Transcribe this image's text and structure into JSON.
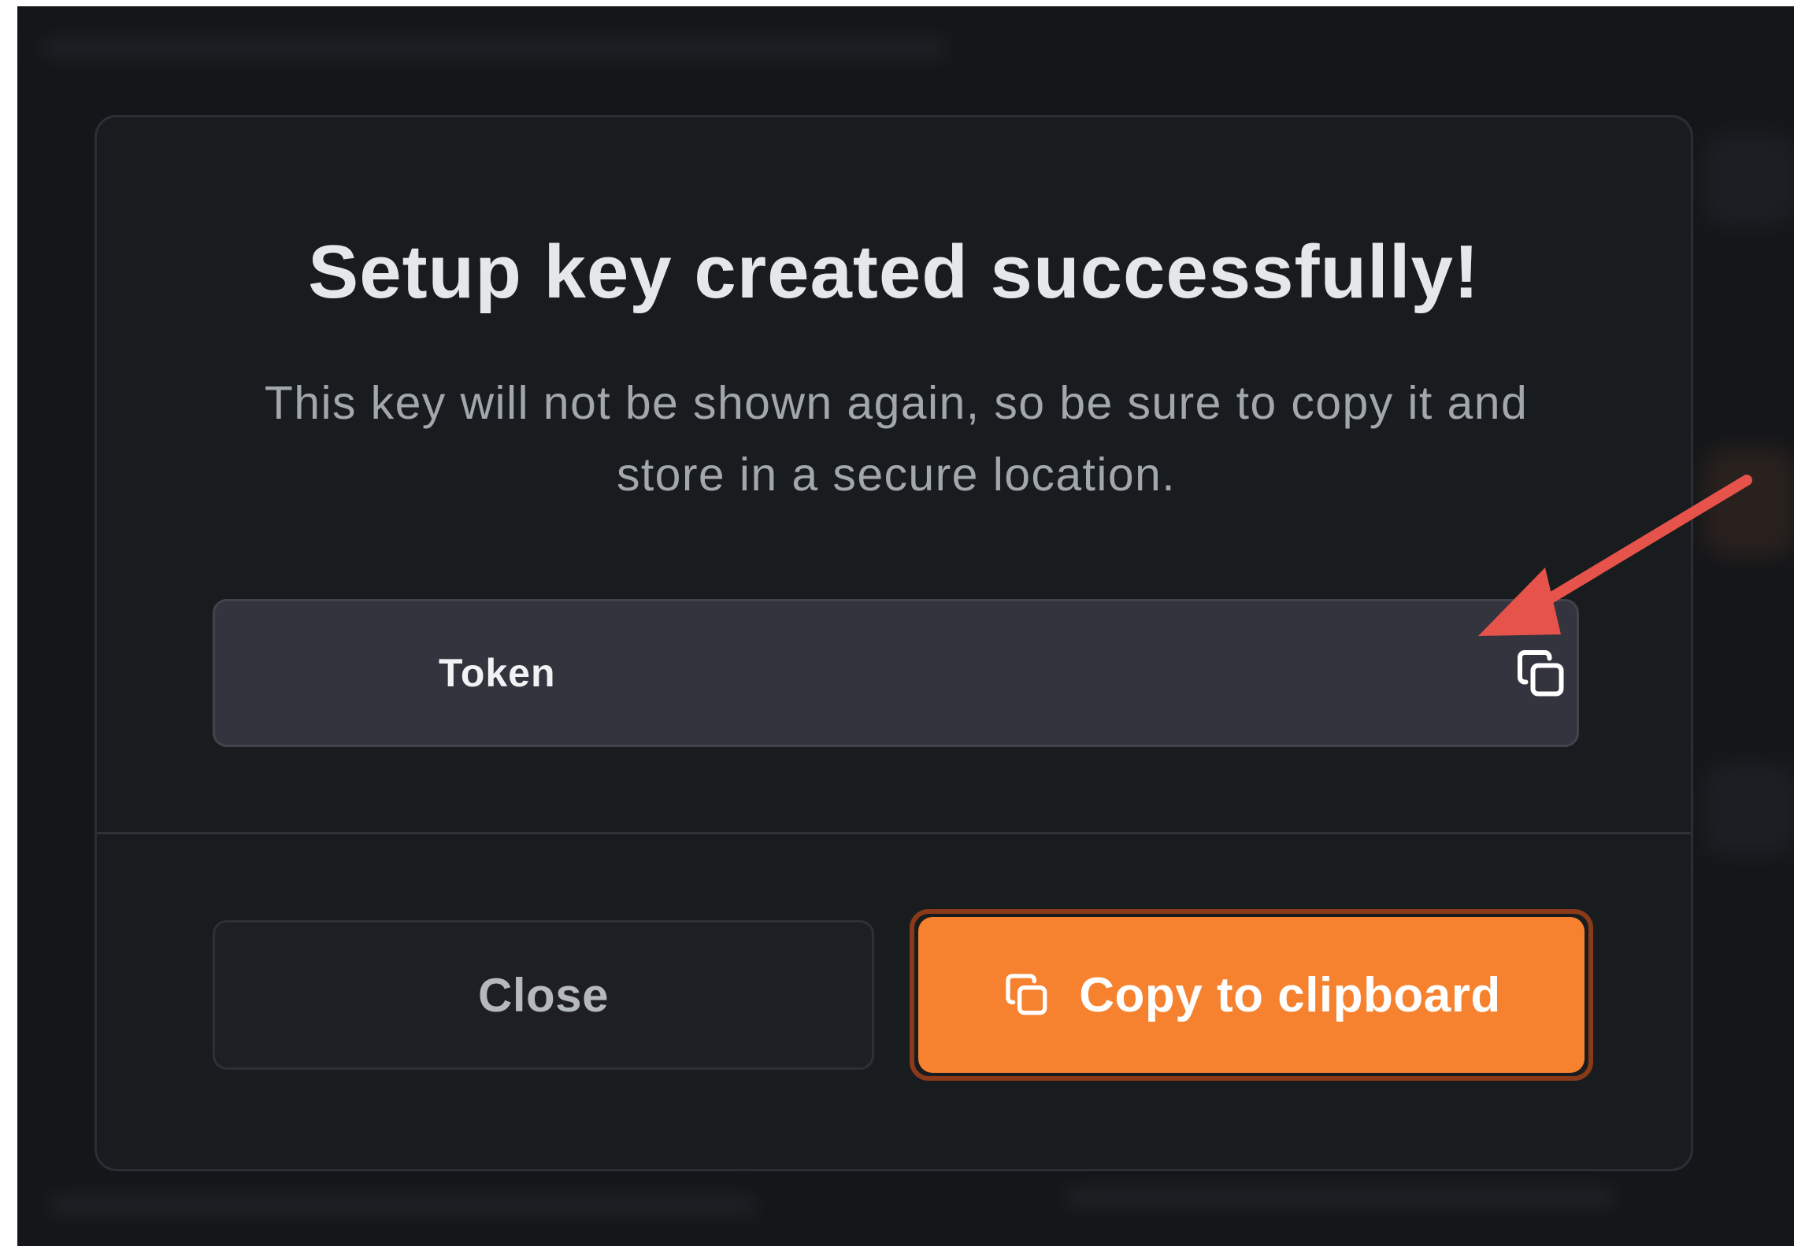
{
  "dialog": {
    "title": "Setup key created successfully!",
    "subtitle": "This key will not be shown again, so be sure to copy it and store in a secure location.",
    "token_label": "Token"
  },
  "actions": {
    "close_label": "Close",
    "copy_label": "Copy to clipboard"
  },
  "icons": {
    "token_copy": "copy-icon",
    "button_copy": "copy-icon"
  },
  "colors": {
    "accent": "#f6822f",
    "annotation_arrow": "#e5534b",
    "modal_bg": "#191c1f",
    "token_bg": "#33343e"
  }
}
